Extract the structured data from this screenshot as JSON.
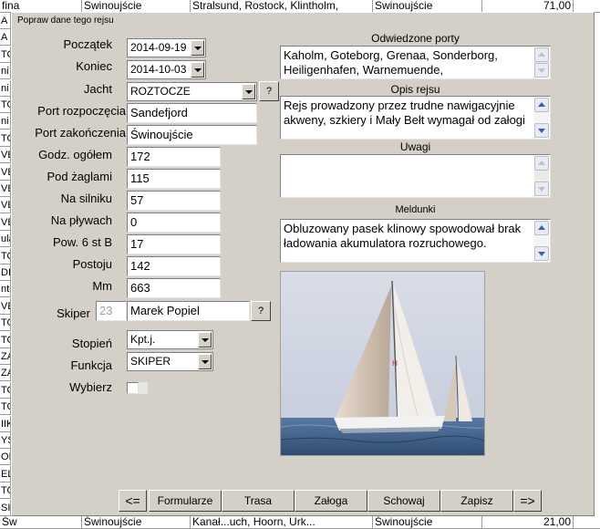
{
  "spreadsheet": {
    "top_row": [
      "fina",
      "Swinoujście",
      "Stralsund, Rostock, Klintholm,",
      "Swinoujście",
      "71,00"
    ],
    "bottom_row": [
      "Św",
      "Świnoujście",
      "Kanał...uch, Hoorn, Urk...",
      "Świnoujście",
      "21,00"
    ],
    "left_column": [
      "A",
      "A",
      "TO",
      "ni",
      "ni",
      "TO",
      "ni",
      "TO",
      "VE",
      "VE",
      "VE",
      "VE",
      "VE",
      "ula",
      "TO",
      "DI",
      "ntr",
      "VE",
      "TO",
      "TO",
      "ZA",
      "ZA",
      "TO",
      "TO",
      "IIK",
      "YS",
      "OI",
      "EL",
      "TO",
      "SI"
    ]
  },
  "dialog": {
    "title": "Popraw dane tego rejsu",
    "form": {
      "start_label": "Początek",
      "start_value": "2014-09-19",
      "end_label": "Koniec",
      "end_value": "2014-10-03",
      "yacht_label": "Jacht",
      "yacht_value": "ROZTOCZE",
      "port_start_label": "Port rozpoczęcia",
      "port_start_value": "Sandefjord",
      "port_end_label": "Port zakończenia",
      "port_end_value": "Świnoujście",
      "hours_total_label": "Godz. ogółem",
      "hours_total_value": "172",
      "under_sail_label": "Pod żaglami",
      "under_sail_value": "115",
      "engine_label": "Na silniku",
      "engine_value": "57",
      "floating_label": "Na pływach",
      "floating_value": "0",
      "storm_label": "Pow. 6 st B",
      "storm_value": "17",
      "harbor_label": "Postoju",
      "harbor_value": "142",
      "mm_label": "Mm",
      "mm_value": "663",
      "skipper_label": "Skiper",
      "skipper_id": "23",
      "skipper_name": "Marek Popiel",
      "rank_label": "Stopień",
      "rank_value": "Kpt.j.",
      "function_label": "Funkcja",
      "function_value": "SKIPER",
      "select_label": "Wybierz",
      "help_glyph": "?"
    },
    "ports": {
      "label": "Odwiedzone porty",
      "text": "Kaholm, Goteborg, Grenaa, Sonderborg,\nHeiligenhafen, Warnemuende,"
    },
    "description": {
      "label": "Opis rejsu",
      "text": "Rejs prowadzony przez trudne nawigacyjnie\nakweny, szkiery i Mały Bełt wymagał od załogi"
    },
    "remarks": {
      "label": "Uwagi",
      "text": ""
    },
    "reports": {
      "label": "Meldunki",
      "text": "Obluzowany pasek klinowy spowodował  brak\nładowania akumulatora rozruchowego."
    },
    "nav": {
      "prev": "<=",
      "forms": "Formularze",
      "route": "Trasa",
      "crew": "Załoga",
      "hide": "Schowaj",
      "save": "Zapisz",
      "next": "=>"
    },
    "colors": {
      "dialog_bg": "#d4d0c8",
      "sky": "#cbd2e0",
      "sea": "#41618a",
      "hull": "#f2f2f0"
    },
    "photo_icon": "sailboat-photo"
  }
}
